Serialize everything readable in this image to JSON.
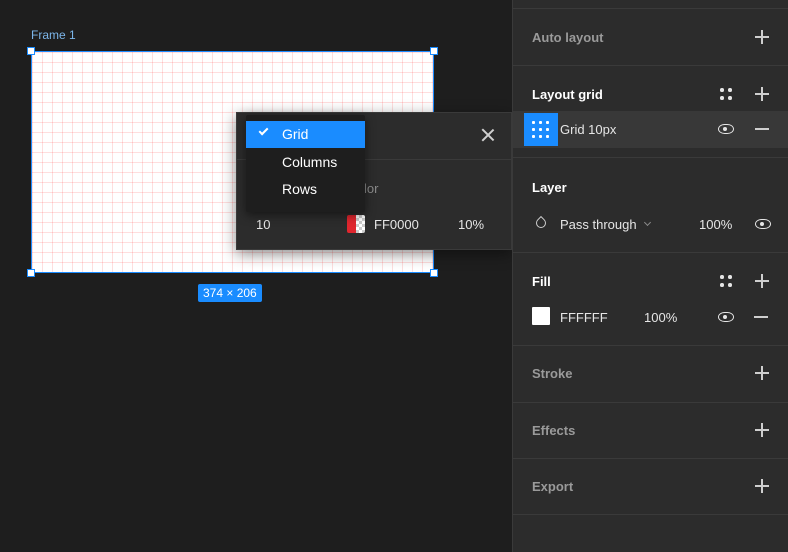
{
  "canvas": {
    "frame_label": "Frame 1",
    "size_badge": "374 × 206"
  },
  "grid_popover": {
    "type_menu": {
      "items": [
        {
          "label": "Grid",
          "selected": true
        },
        {
          "label": "Columns",
          "selected": false
        },
        {
          "label": "Rows",
          "selected": false
        }
      ]
    },
    "color_header_partial": "lor",
    "size_value": "10",
    "color_hex": "FF0000",
    "color_swatch": "#e0262e",
    "opacity": "10%"
  },
  "panel": {
    "auto_layout": {
      "title": "Auto layout"
    },
    "layout_grid": {
      "title": "Layout grid",
      "item_label": "Grid 10px"
    },
    "layer": {
      "title": "Layer",
      "blend_mode": "Pass through",
      "opacity": "100%"
    },
    "fill": {
      "title": "Fill",
      "hex": "FFFFFF",
      "opacity": "100%",
      "swatch": "#ffffff"
    },
    "stroke": {
      "title": "Stroke"
    },
    "effects": {
      "title": "Effects"
    },
    "export": {
      "title": "Export"
    }
  },
  "colors": {
    "accent": "#1a8cff",
    "panel_bg": "#2c2c2c",
    "canvas_bg": "#1e1e1e"
  },
  "icons": [
    "plus-icon",
    "minus-icon",
    "eye-icon",
    "style-dots-icon",
    "grid-icon",
    "close-icon",
    "check-icon",
    "blend-drop-icon",
    "chevron-down-icon"
  ]
}
